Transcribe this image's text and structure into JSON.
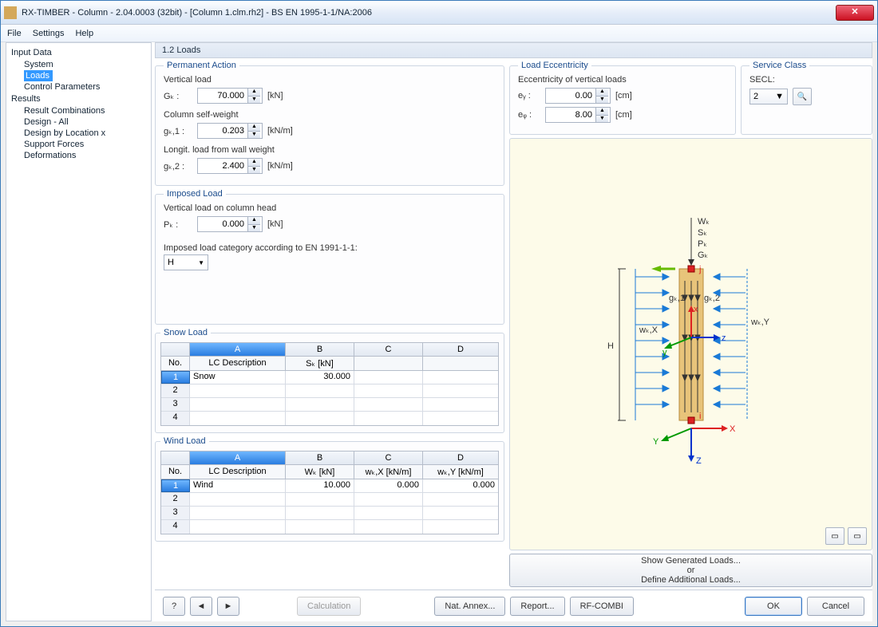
{
  "title": "RX-TIMBER - Column - 2.04.0003 (32bit) - [Column 1.clm.rh2] - BS EN 1995-1-1/NA:2006",
  "menu": {
    "file": "File",
    "settings": "Settings",
    "help": "Help"
  },
  "tree": {
    "input_data": "Input Data",
    "system": "System",
    "loads": "Loads",
    "control_params": "Control Parameters",
    "results": "Results",
    "result_combinations": "Result Combinations",
    "design_all": "Design - All",
    "design_x": "Design by Location x",
    "support_forces": "Support Forces",
    "deformations": "Deformations"
  },
  "page_title": "1.2 Loads",
  "permanent": {
    "legend": "Permanent Action",
    "vertical_load": "Vertical load",
    "gk_label": "Gₖ :",
    "gk_value": "70.000",
    "kn": "[kN]",
    "col_self_weight": "Column self-weight",
    "gk1_label": "gₖ,1 :",
    "gk1_value": "0.203",
    "knm": "[kN/m]",
    "longit": "Longit. load from wall weight",
    "gk2_label": "gₖ,2 :",
    "gk2_value": "2.400"
  },
  "imposed": {
    "legend": "Imposed Load",
    "vertical_head": "Vertical load on column head",
    "pk_label": "Pₖ :",
    "pk_value": "0.000",
    "category_label": "Imposed load category according to EN 1991-1-1:",
    "category_value": "H"
  },
  "snow": {
    "legend": "Snow Load",
    "colA": "A",
    "colB": "B",
    "colC": "C",
    "colD": "D",
    "hNo": "No.",
    "hDesc": "LC Description",
    "hSk": "Sₖ [kN]",
    "r1_no": "1",
    "r1_desc": "Snow",
    "r1_sk": "30.000",
    "r2": "2",
    "r3": "3",
    "r4": "4"
  },
  "wind": {
    "legend": "Wind Load",
    "colA": "A",
    "colB": "B",
    "colC": "C",
    "colD": "D",
    "hNo": "No.",
    "hDesc": "LC Description",
    "hWk": "Wₖ [kN]",
    "hWkx": "wₖ,X [kN/m]",
    "hWky": "wₖ,Y [kN/m]",
    "r1_no": "1",
    "r1_desc": "Wind",
    "r1_wk": "10.000",
    "r1_wkx": "0.000",
    "r1_wky": "0.000",
    "r2": "2",
    "r3": "3",
    "r4": "4"
  },
  "ecc": {
    "legend": "Load Eccentricity",
    "title": "Eccentricity of vertical loads",
    "ey_label": "eᵧ :",
    "ey_value": "0.00",
    "ez_label": "eᵩ :",
    "ez_value": "8.00",
    "cm": "[cm]"
  },
  "service": {
    "legend": "Service Class",
    "label": "SECL:",
    "value": "2"
  },
  "gen_loads": {
    "show": "Show Generated Loads...",
    "or": "or",
    "define": "Define Additional Loads..."
  },
  "footer": {
    "calculation": "Calculation",
    "nat_annex": "Nat. Annex...",
    "report": "Report...",
    "rfcombi": "RF-COMBI",
    "ok": "OK",
    "cancel": "Cancel"
  },
  "diagram": {
    "H": "H",
    "Wk": "Wₖ",
    "Sk": "Sₖ",
    "Pk": "Pₖ",
    "Gk": "Gₖ",
    "gk1": "gₖ,1",
    "gk2": "gₖ,2",
    "wkX": "wₖ,X",
    "wkY": "wₖ,Y",
    "x": "x",
    "y": "y",
    "z": "z",
    "X": "X",
    "Y": "Y",
    "Z": "Z",
    "i": "i",
    "j": "j"
  }
}
